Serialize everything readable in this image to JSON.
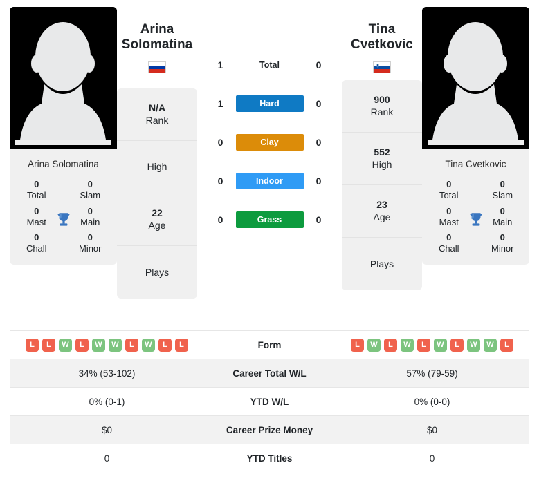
{
  "players": {
    "left": {
      "name_line1": "Arina",
      "name_line2": "Solomatina",
      "full_name": "Arina Solomatina",
      "country": "Russia",
      "flag_icon": "flag-russia-icon",
      "photo_icon": "player-silhouette-icon",
      "info": [
        {
          "value": "N/A",
          "label": "Rank"
        },
        {
          "value": "",
          "label": "High"
        },
        {
          "value": "22",
          "label": "Age"
        },
        {
          "value": "",
          "label": "Plays"
        }
      ],
      "awards": [
        {
          "value": "0",
          "label": "Total"
        },
        {
          "value": "0",
          "label": "Slam"
        },
        {
          "value": "0",
          "label": "Mast"
        },
        {
          "value": "0",
          "label": "Main"
        },
        {
          "value": "0",
          "label": "Chall"
        },
        {
          "value": "0",
          "label": "Minor"
        }
      ],
      "form": [
        "L",
        "L",
        "W",
        "L",
        "W",
        "W",
        "L",
        "W",
        "L",
        "L"
      ],
      "career_total_wl": "34% (53-102)",
      "ytd_wl": "0% (0-1)",
      "career_prize_money": "$0",
      "ytd_titles": "0"
    },
    "right": {
      "name_line1": "Tina",
      "name_line2": "Cvetkovic",
      "full_name": "Tina Cvetkovic",
      "country": "Slovenia",
      "flag_icon": "flag-slovenia-icon",
      "photo_icon": "player-silhouette-icon",
      "info": [
        {
          "value": "900",
          "label": "Rank"
        },
        {
          "value": "552",
          "label": "High"
        },
        {
          "value": "23",
          "label": "Age"
        },
        {
          "value": "",
          "label": "Plays"
        }
      ],
      "awards": [
        {
          "value": "0",
          "label": "Total"
        },
        {
          "value": "0",
          "label": "Slam"
        },
        {
          "value": "0",
          "label": "Mast"
        },
        {
          "value": "0",
          "label": "Main"
        },
        {
          "value": "0",
          "label": "Chall"
        },
        {
          "value": "0",
          "label": "Minor"
        }
      ],
      "form": [
        "L",
        "W",
        "L",
        "W",
        "L",
        "W",
        "L",
        "W",
        "W",
        "L"
      ],
      "career_total_wl": "57% (79-59)",
      "ytd_wl": "0% (0-0)",
      "career_prize_money": "$0",
      "ytd_titles": "0"
    }
  },
  "head_to_head": [
    {
      "label": "Total",
      "left": "1",
      "right": "0",
      "color": "",
      "style": "plain"
    },
    {
      "label": "Hard",
      "left": "1",
      "right": "0",
      "color": "#0f7ac4",
      "style": "badge"
    },
    {
      "label": "Clay",
      "left": "0",
      "right": "0",
      "color": "#dc8c09",
      "style": "badge"
    },
    {
      "label": "Indoor",
      "left": "0",
      "right": "0",
      "color": "#2f9bf5",
      "style": "badge"
    },
    {
      "label": "Grass",
      "left": "0",
      "right": "0",
      "color": "#0d9b3e",
      "style": "badge"
    }
  ],
  "stats_rows": [
    {
      "label": "Form",
      "key": "form",
      "type": "chips"
    },
    {
      "label": "Career Total W/L",
      "key": "career_total_wl",
      "type": "text"
    },
    {
      "label": "YTD W/L",
      "key": "ytd_wl",
      "type": "text"
    },
    {
      "label": "Career Prize Money",
      "key": "career_prize_money",
      "type": "text"
    },
    {
      "label": "YTD Titles",
      "key": "ytd_titles",
      "type": "text"
    }
  ],
  "colors": {
    "win": "#7cc47f",
    "loss": "#f0624d",
    "card_bg": "#f0f0f0",
    "row_shade": "#f2f2f2"
  },
  "icons": {
    "trophy": "trophy-icon"
  }
}
